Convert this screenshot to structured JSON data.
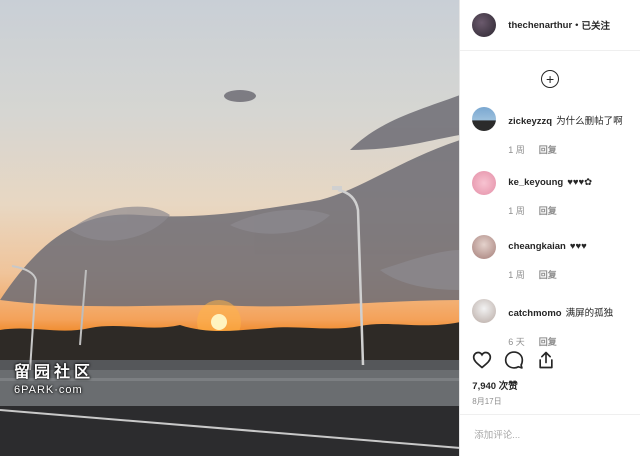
{
  "watermark": {
    "title": "留园社区",
    "subtitle": "6PARK·com"
  },
  "post": {
    "username": "thechenarthur",
    "separator": "•",
    "follow_state": "已关注",
    "add_icon": "+",
    "likes": "7,940 次赞",
    "date": "8月17日",
    "comment_placeholder": "添加评论..."
  },
  "comments": [
    {
      "user": "zickeyzzq",
      "text": "为什么删帖了啊",
      "time": "1 周",
      "reply": "回复"
    },
    {
      "user": "ke_keyoung",
      "text": "♥♥♥✿",
      "time": "1 周",
      "reply": "回复"
    },
    {
      "user": "cheangkaian",
      "text": "♥♥♥",
      "time": "1 周",
      "reply": "回复"
    },
    {
      "user": "catchmomo",
      "text": "满屏的孤独",
      "time": "6 天",
      "reply": "回复"
    }
  ],
  "icons": {
    "like": "heart-icon",
    "comment": "comment-icon",
    "share": "share-icon"
  }
}
